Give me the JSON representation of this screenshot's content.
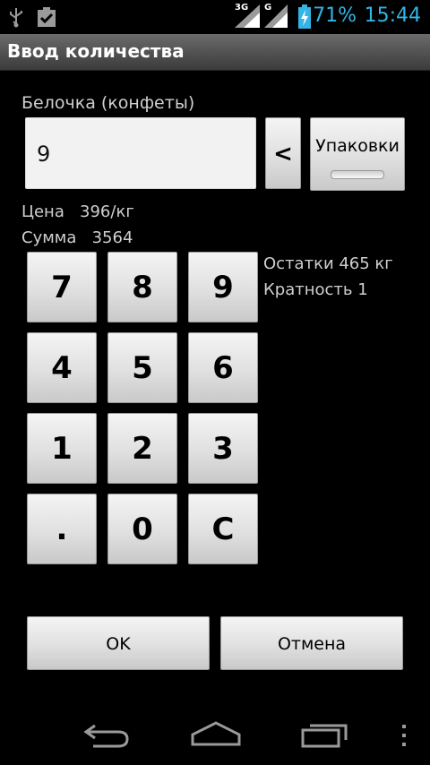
{
  "status_bar": {
    "network_3g": "3G",
    "network_g": "G",
    "battery": "71%",
    "time": "15:44",
    "icons": [
      "usb-icon",
      "clipboard-check-icon",
      "signal-3g-icon",
      "signal-g-icon",
      "battery-charging-icon"
    ]
  },
  "title": "Ввод количества",
  "product_name": "Белочка (конфеты)",
  "quantity_value": "9",
  "buttons": {
    "backspace": "<",
    "packages": "Упаковки",
    "ok": "OK",
    "cancel": "Отмена"
  },
  "price": {
    "label": "Цена",
    "value": "396/кг"
  },
  "sum": {
    "label": "Сумма",
    "value": "3564"
  },
  "stock": "Остатки 465 кг",
  "multiplicity": "Кратность 1",
  "keypad": {
    "k7": "7",
    "k8": "8",
    "k9": "9",
    "k4": "4",
    "k5": "5",
    "k6": "6",
    "k1": "1",
    "k2": "2",
    "k3": "3",
    "kdot": ".",
    "k0": "0",
    "kc": "C"
  },
  "colors": {
    "accent": "#33b5e5",
    "background": "#000000"
  }
}
